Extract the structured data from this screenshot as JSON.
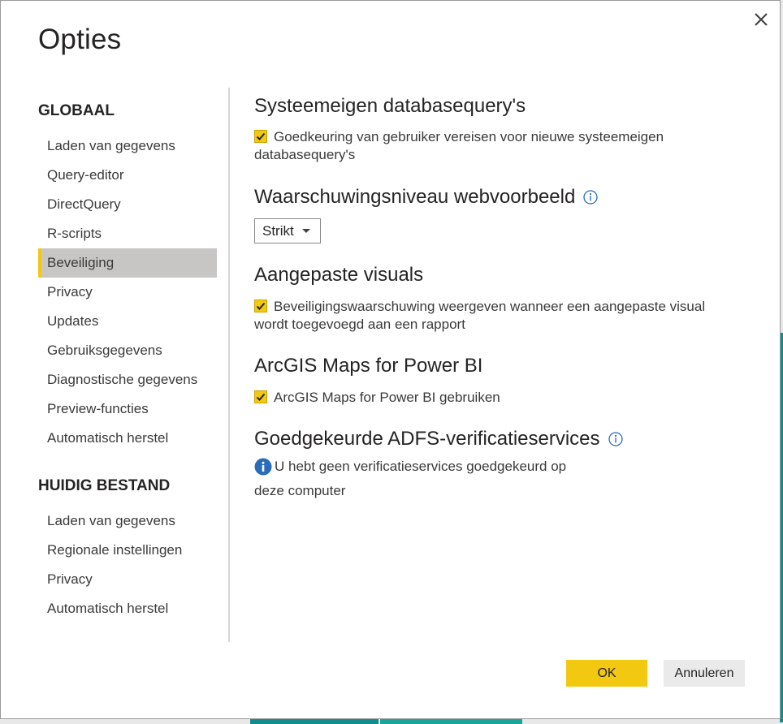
{
  "dialog": {
    "title": "Opties",
    "close_icon": "close-icon"
  },
  "sidebar": {
    "global_heading": "GLOBAAL",
    "global_items": [
      {
        "label": "Laden van gegevens"
      },
      {
        "label": "Query-editor"
      },
      {
        "label": "DirectQuery"
      },
      {
        "label": "R-scripts"
      },
      {
        "label": "Beveiliging",
        "selected": true
      },
      {
        "label": "Privacy"
      },
      {
        "label": "Updates"
      },
      {
        "label": "Gebruiksgegevens"
      },
      {
        "label": "Diagnostische gegevens"
      },
      {
        "label": "Preview-functies"
      },
      {
        "label": "Automatisch herstel"
      }
    ],
    "file_heading": "HUIDIG BESTAND",
    "file_items": [
      {
        "label": "Laden van gegevens"
      },
      {
        "label": "Regionale instellingen"
      },
      {
        "label": "Privacy"
      },
      {
        "label": "Automatisch herstel"
      }
    ]
  },
  "main": {
    "native_queries": {
      "title": "Systeemeigen databasequery's",
      "checkbox_label_line1": "Goedkeuring van gebruiker vereisen voor nieuwe systeemeigen",
      "checkbox_label_line2": "databasequery's",
      "checked": true
    },
    "web_preview": {
      "title": "Waarschuwingsniveau webvoorbeeld",
      "dropdown_value": "Strikt"
    },
    "custom_visuals": {
      "title": "Aangepaste visuals",
      "checkbox_label_line1": "Beveiligingswaarschuwing weergeven wanneer een aangepaste visual",
      "checkbox_label_line2": "wordt toegevoegd aan een rapport",
      "checked": true
    },
    "arcgis": {
      "title": "ArcGIS Maps for Power BI",
      "checkbox_label": "ArcGIS Maps for Power BI gebruiken",
      "checked": true
    },
    "adfs": {
      "title": "Goedgekeurde ADFS-verificatieservices",
      "info_line1": "U hebt geen verificatieservices goedgekeurd op",
      "info_line2": "deze computer"
    }
  },
  "footer": {
    "ok_label": "OK",
    "cancel_label": "Annuleren"
  },
  "colors": {
    "accent": "#f2c811",
    "selected_bg": "#c8c6c4",
    "info_blue": "#2b6cb8",
    "background_teal": "#118d8d"
  }
}
